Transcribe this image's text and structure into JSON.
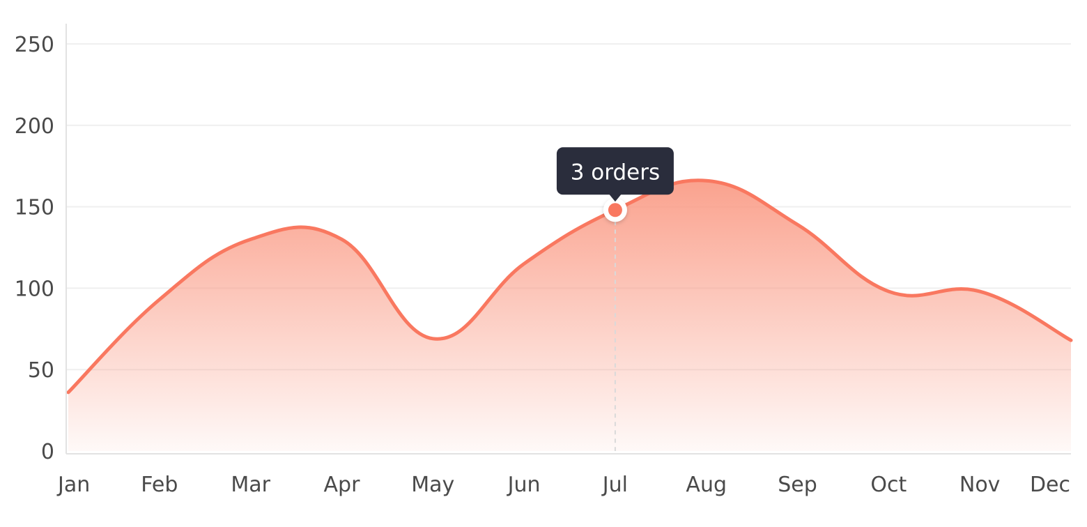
{
  "chart_data": {
    "type": "area",
    "x": [
      "Jan",
      "Feb",
      "Mar",
      "Apr",
      "May",
      "Jun",
      "Jul",
      "Aug",
      "Sep",
      "Oct",
      "Nov",
      "Dec"
    ],
    "series": [
      {
        "values": [
          36,
          93,
          130,
          130,
          69,
          115,
          148,
          166,
          139,
          98,
          98,
          68
        ],
        "color": "#f97860"
      }
    ],
    "ylim": [
      0,
      250
    ],
    "yticks": [
      0,
      50,
      100,
      150,
      200,
      250
    ],
    "ytick_labels": [
      "0",
      "50",
      "100",
      "150",
      "200",
      "250"
    ],
    "grid": true,
    "fill": "gradient",
    "tooltip": {
      "category": "Jul",
      "text": "3 orders"
    }
  },
  "colors": {
    "line": "#f97860",
    "fill_top": "#fa9d88",
    "grid": "#efefef",
    "axis": "#e2e2e2",
    "tick_text": "#4a4a4a",
    "tooltip_bg": "#2a2d3c",
    "tooltip_text": "#ffffff",
    "crosshair": "#d9d9d9"
  }
}
